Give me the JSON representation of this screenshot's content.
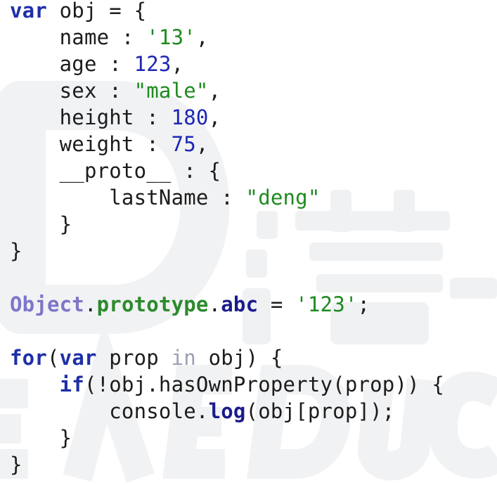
{
  "code": {
    "l1": {
      "kw": "var",
      "rest": " obj = {"
    },
    "l2": {
      "key": "    name : ",
      "str": "'13'",
      "tail": ","
    },
    "l3": {
      "key": "    age : ",
      "num": "123",
      "tail": ","
    },
    "l4": {
      "key": "    sex : ",
      "str": "\"male\"",
      "tail": ","
    },
    "l5": {
      "key": "    height : ",
      "num": "180",
      "tail": ","
    },
    "l6": {
      "key": "    weight : ",
      "num": "75",
      "tail": ","
    },
    "l7": {
      "key": "    __proto__ : {"
    },
    "l8": {
      "key": "        lastName : ",
      "str": "\"deng\""
    },
    "l9": {
      "text": "    }"
    },
    "l10": {
      "text": "}"
    },
    "l12": {
      "cls": "Object",
      "dot1": ".",
      "prop": "prototype",
      "dot2": ".",
      "abc": "abc",
      "eq": " = ",
      "str": "'123'",
      "tail": ";"
    },
    "l14": {
      "kw": "for",
      "p1": "(",
      "kw2": "var",
      "mid": " prop ",
      "in": "in",
      "rest": " obj) {"
    },
    "l15": {
      "indent": "    ",
      "kw": "if",
      "rest": "(!obj.hasOwnProperty(prop)) {"
    },
    "l16": {
      "pre": "        console.",
      "log": "log",
      "rest": "(obj[prop]);"
    },
    "l17": {
      "text": "    }"
    },
    "l18": {
      "text": "}"
    }
  },
  "colors": {
    "keyword": "#1f2fa8",
    "string": "#1f8a1f",
    "number": "#1d27b5",
    "watermark": "#f0f1f3"
  }
}
